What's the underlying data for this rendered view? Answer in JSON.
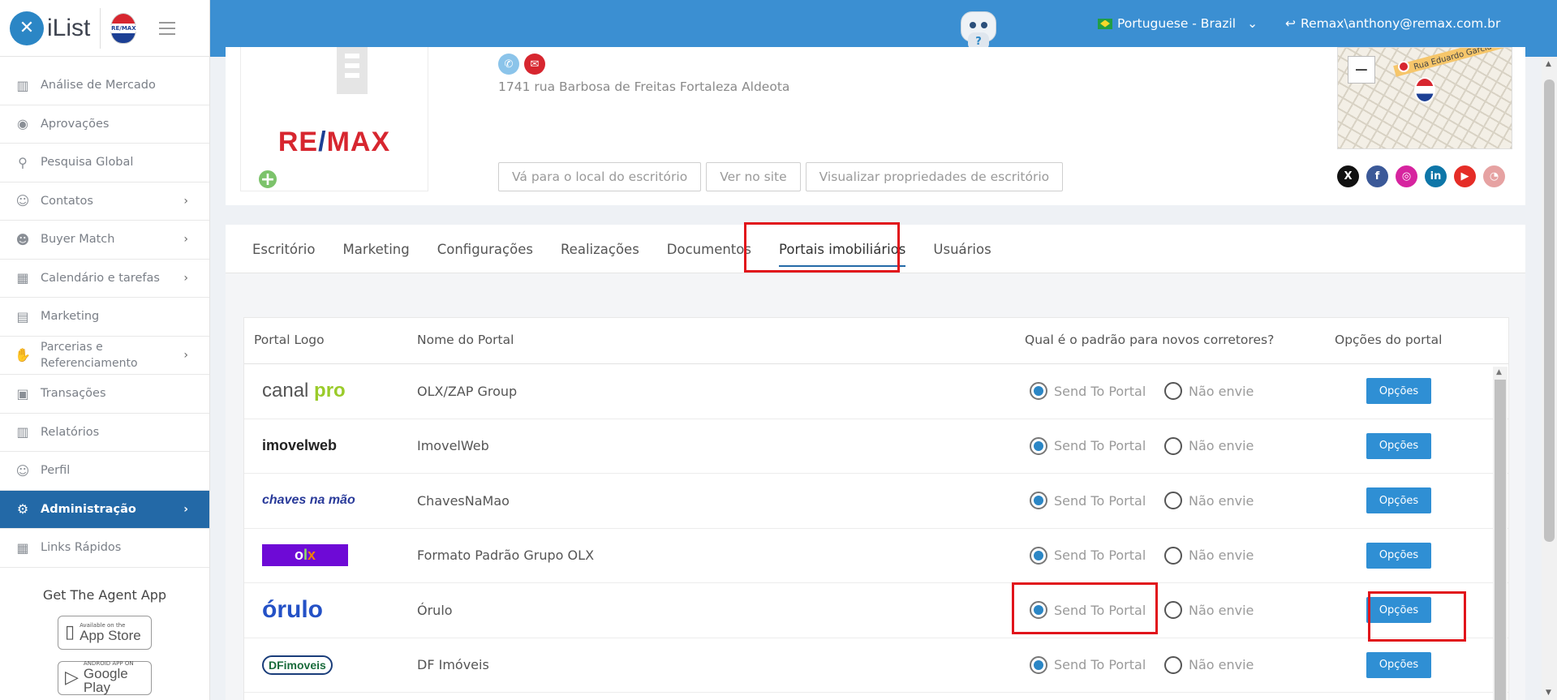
{
  "brand": {
    "name": "iList",
    "logo_letter": "✕",
    "balloon_text": "RE/MAX"
  },
  "topbar": {
    "language": "Portuguese - Brazil",
    "user": "Remax\\anthony@remax.com.br",
    "robot_badge": "?"
  },
  "sidebar": {
    "items": [
      {
        "label": "Análise de Mercado",
        "icon": "bar-chart-icon",
        "glyph": "▥",
        "chevron": false
      },
      {
        "label": "Aprovações",
        "icon": "eye-icon",
        "glyph": "◉",
        "chevron": false
      },
      {
        "label": "Pesquisa Global",
        "icon": "search-icon",
        "glyph": "⚲",
        "chevron": false
      },
      {
        "label": "Contatos",
        "icon": "contacts-icon",
        "glyph": "☺",
        "chevron": true
      },
      {
        "label": "Buyer Match",
        "icon": "buyer-icon",
        "glyph": "☻",
        "chevron": true
      },
      {
        "label": "Calendário e tarefas",
        "icon": "calendar-icon",
        "glyph": "▦",
        "chevron": true
      },
      {
        "label": "Marketing",
        "icon": "book-icon",
        "glyph": "▤",
        "chevron": false
      },
      {
        "label": "Parcerias e Referenciamento",
        "icon": "handshake-icon",
        "glyph": "✋",
        "chevron": true
      },
      {
        "label": "Transações",
        "icon": "briefcase-icon",
        "glyph": "▣",
        "chevron": false
      },
      {
        "label": "Relatórios",
        "icon": "reports-icon",
        "glyph": "▥",
        "chevron": false
      },
      {
        "label": "Perfil",
        "icon": "profile-icon",
        "glyph": "☺",
        "chevron": false
      },
      {
        "label": "Administração",
        "icon": "gear-icon",
        "glyph": "⚙",
        "chevron": true,
        "active": true
      },
      {
        "label": "Links Rápidos",
        "icon": "links-icon",
        "glyph": "▦",
        "chevron": false
      }
    ],
    "chevron_glyph": "›",
    "agent_app": {
      "title": "Get The Agent App",
      "app_store_small": "Available on the",
      "app_store_big": "App Store",
      "google_small": "ANDROID APP ON",
      "google_big": "Google Play"
    }
  },
  "office": {
    "address": "1741 rua Barbosa de Freitas Fortaleza Aldeota",
    "logo_text_1": "RE",
    "logo_text_slash": "/",
    "logo_text_2": "MAX",
    "buttons": [
      "Vá para o local do escritório",
      "Ver no site",
      "Visualizar propriedades de escritório"
    ],
    "map_street": "Rua Eduardo Garcia",
    "map_zoom_out": "−",
    "socials": [
      {
        "name": "x-icon",
        "glyph": "X",
        "color": "#111111"
      },
      {
        "name": "facebook-icon",
        "glyph": "f",
        "color": "#3b5998"
      },
      {
        "name": "instagram-icon",
        "glyph": "◎",
        "color": "#d6249f"
      },
      {
        "name": "linkedin-icon",
        "glyph": "in",
        "color": "#0e76a8"
      },
      {
        "name": "youtube-icon",
        "glyph": "▶",
        "color": "#e52d27"
      },
      {
        "name": "weibo-icon",
        "glyph": "◔",
        "color": "#e6a2a2"
      }
    ]
  },
  "tabs": [
    "Escritório",
    "Marketing",
    "Configurações",
    "Realizações",
    "Documentos",
    "Portais imobiliários",
    "Usuários"
  ],
  "active_tab": "Portais imobiliários",
  "table": {
    "headers": {
      "logo": "Portal Logo",
      "name": "Nome do Portal",
      "default": "Qual é o padrão para novos corretores?",
      "options": "Opções do portal"
    },
    "send_label": "Send To Portal",
    "nosend_label": "Não envie",
    "options_label": "Opções",
    "rows": [
      {
        "name": "OLX/ZAP Group",
        "logo": "canalpro",
        "send": true
      },
      {
        "name": "ImovelWeb",
        "logo": "imovelweb",
        "send": true
      },
      {
        "name": "ChavesNaMao",
        "logo": "chaves",
        "send": true
      },
      {
        "name": "Formato Padrão Grupo OLX",
        "logo": "olx",
        "send": true
      },
      {
        "name": "Órulo",
        "logo": "orulo",
        "send": true
      },
      {
        "name": "DF Imóveis",
        "logo": "dfimoveis",
        "send": true
      }
    ],
    "logo_texts": {
      "canal": "canal",
      "pro": "pro",
      "imovel_i": "i",
      "imovel": "imovelweb",
      "chaves": "chaves na mão",
      "olx_o": "o",
      "olx_l": "l",
      "olx_x": "x",
      "orulo": "órulo",
      "df": "DFimoveis"
    }
  }
}
